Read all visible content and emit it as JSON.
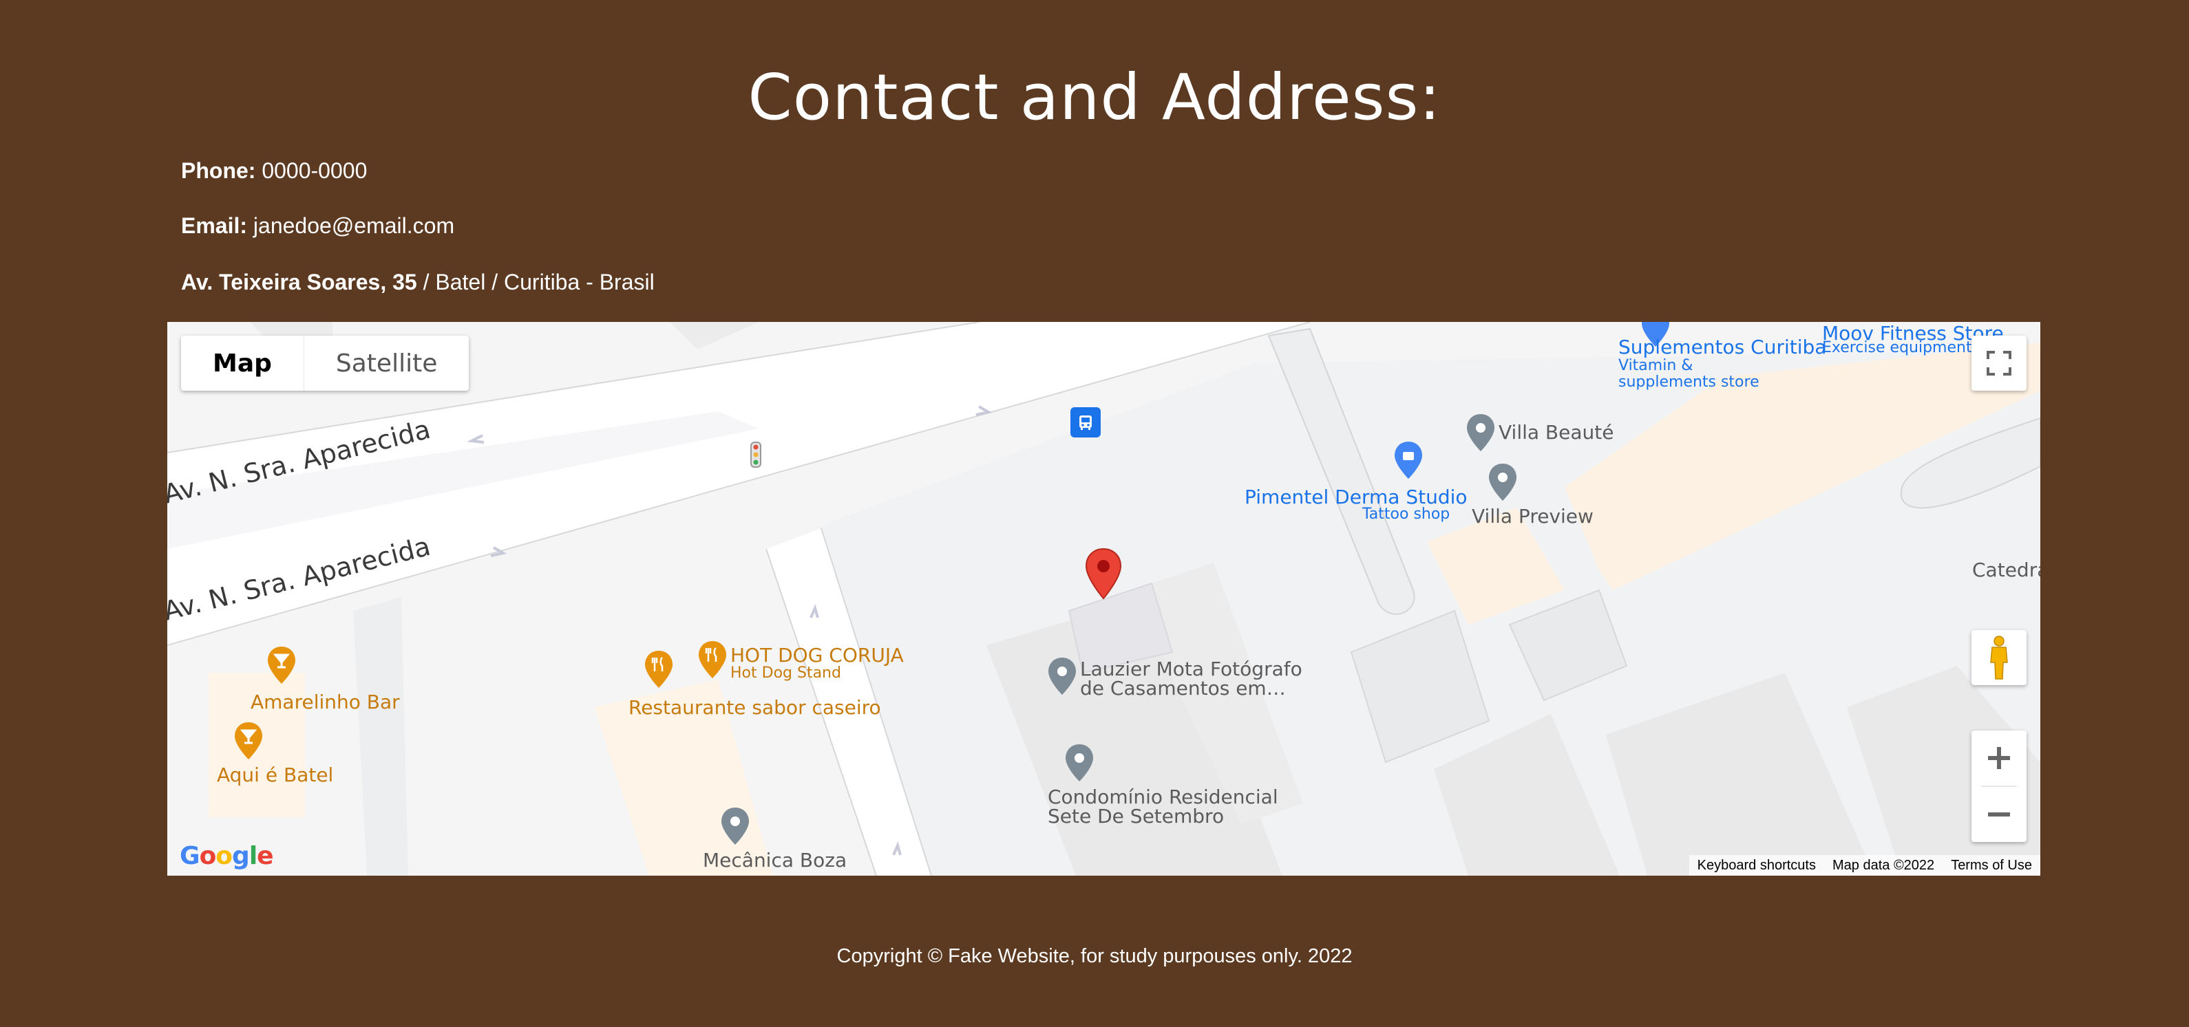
{
  "page": {
    "title": "Contact and Address:",
    "phone_label": "Phone:",
    "phone_value": "0000-0000",
    "email_label": "Email:",
    "email_value": "janedoe@email.com",
    "address_bold": "Av. Teixeira Soares, 35",
    "address_rest": " / Batel / Curitiba - Brasil",
    "footer": "Copyright © Fake Website, for study purpouses only. 2022"
  },
  "map": {
    "type_controls": [
      "Map",
      "Satellite"
    ],
    "streets": [
      "Av. N. Sra. Aparecida",
      "Av. N. Sra. Aparecida"
    ],
    "pois": {
      "suplementos": "Suplementos Curitiba",
      "suplementos_sub1": "Vitamin &",
      "suplementos_sub2": "supplements store",
      "moov": "Moov Fitness Store",
      "moov_sub": "Exercise equipment st",
      "villa_beaute": "Villa Beauté",
      "villa_preview": "Villa Preview",
      "pimentel": "Pimentel Derma Studio",
      "pimentel_sub": "Tattoo shop",
      "catedral": "Catedra",
      "hotdog": "HOT DOG CORUJA",
      "hotdog_sub": "Hot Dog Stand",
      "restaurante": "Restaurante sabor caseiro",
      "amarelinho": "Amarelinho Bar",
      "aqui": "Aqui é Batel",
      "lauzier1": "Lauzier Mota Fotógrafo",
      "lauzier2": "de Casamentos em…",
      "condominio1": "Condomínio Residencial",
      "condominio2": "Sete De Setembro",
      "mecanica": "Mecânica Boza"
    },
    "logo": "Google",
    "attribution": [
      "Keyboard shortcuts",
      "Map data ©2022",
      "Terms of Use"
    ],
    "colors": {
      "marker": "#ea4335",
      "poi_orange": "#e8930c",
      "poi_gray": "#7b8a94",
      "poi_blue": "#4285f4",
      "transit": "#1a73e8"
    }
  }
}
